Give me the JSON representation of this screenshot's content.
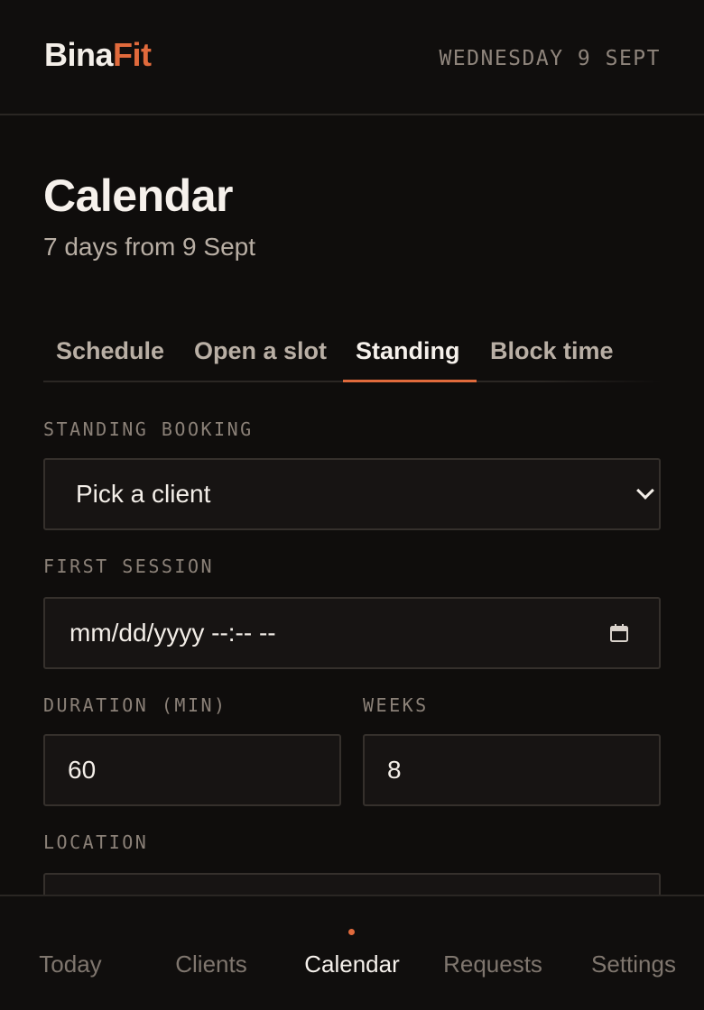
{
  "brand": {
    "part1": "Bina",
    "part2": "Fit"
  },
  "header": {
    "date": "WEDNESDAY 9 SEPT"
  },
  "page": {
    "title": "Calendar",
    "subtitle": "7 days from 9 Sept"
  },
  "tabs": [
    {
      "label": "Schedule",
      "active": false
    },
    {
      "label": "Open a slot",
      "active": false
    },
    {
      "label": "Standing",
      "active": true
    },
    {
      "label": "Block time",
      "active": false
    }
  ],
  "form": {
    "client": {
      "label": "STANDING BOOKING",
      "value": "Pick a client"
    },
    "first_session": {
      "label": "FIRST SESSION",
      "value": "mm/dd/yyyy --:-- --"
    },
    "duration": {
      "label": "DURATION (MIN)",
      "value": "60"
    },
    "weeks": {
      "label": "WEEKS",
      "value": "8"
    },
    "location": {
      "label": "LOCATION",
      "value": ""
    }
  },
  "nav": {
    "items": [
      {
        "label": "Today",
        "active": false
      },
      {
        "label": "Clients",
        "active": false
      },
      {
        "label": "Calendar",
        "active": true
      },
      {
        "label": "Requests",
        "active": false
      },
      {
        "label": "Settings",
        "active": false
      }
    ]
  },
  "colors": {
    "accent": "#e06a3c",
    "background": "#0f0d0c",
    "field": "#171413",
    "border": "#35302c"
  },
  "icons": {
    "select": "chevron-down-icon",
    "date": "calendar-icon"
  }
}
